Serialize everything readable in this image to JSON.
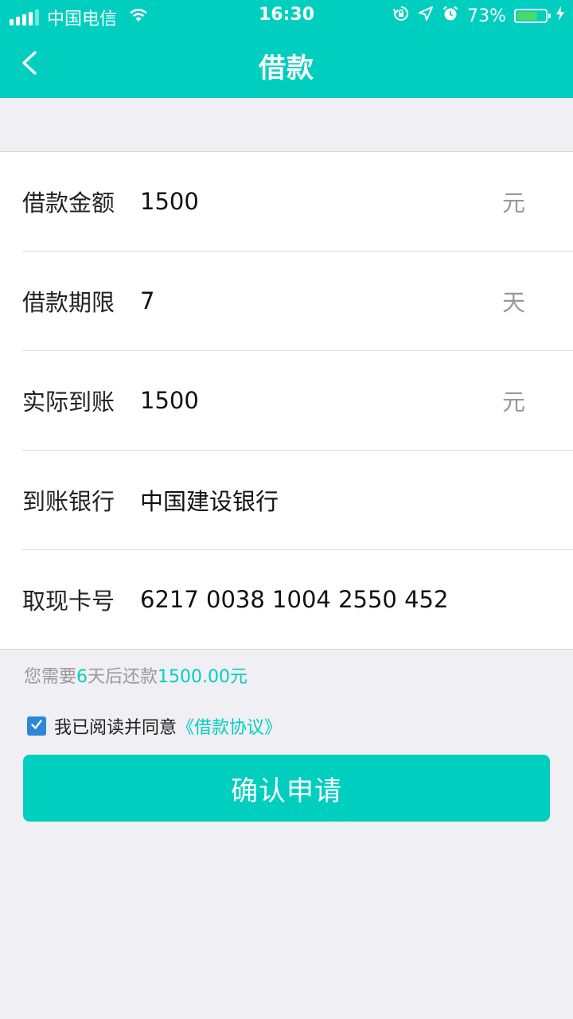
{
  "status_bar": {
    "carrier": "中国电信",
    "time": "16:30",
    "battery_percent": "73%",
    "battery_level": 0.73,
    "signal_bars": 4,
    "icons": [
      "signal-icon",
      "wifi-icon",
      "rotation-lock-icon",
      "location-icon",
      "alarm-icon",
      "battery-icon",
      "charging-icon"
    ]
  },
  "nav": {
    "title": "借款",
    "back_icon": "chevron-left-icon"
  },
  "form": {
    "rows": [
      {
        "label": "借款金额",
        "value": "1500",
        "unit": "元"
      },
      {
        "label": "借款期限",
        "value": "7",
        "unit": "天"
      },
      {
        "label": "实际到账",
        "value": "1500",
        "unit": "元"
      },
      {
        "label": "到账银行",
        "value": "中国建设银行",
        "unit": ""
      },
      {
        "label": "取现卡号",
        "value": "6217 0038 1004 2550 452",
        "unit": ""
      }
    ]
  },
  "note": {
    "prefix": "您需要",
    "days": "6",
    "middle": "天后还款",
    "amount": "1500.00元"
  },
  "agreement": {
    "checked": true,
    "text": "我已阅读并同意",
    "link": "《借款协议》"
  },
  "submit": {
    "label": "确认申请"
  },
  "colors": {
    "accent": "#00cfc0",
    "checkbox": "#2d87d8",
    "background": "#efeff4"
  }
}
